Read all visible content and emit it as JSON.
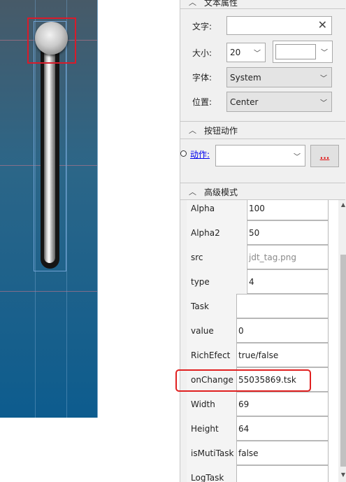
{
  "text_section": {
    "header": "文本属性",
    "text_label": "文字:",
    "text_value": "",
    "size_label": "大小:",
    "size_value": "20",
    "size_color_value": "",
    "font_label": "字体:",
    "font_value": "System",
    "position_label": "位置:",
    "position_value": "Center"
  },
  "button_action_section": {
    "header": "按钮动作",
    "action_link": "动作:",
    "action_value": "",
    "browse_label": "..."
  },
  "advanced_section": {
    "header": "高级模式",
    "properties": [
      {
        "key": "Alpha",
        "value": "100"
      },
      {
        "key": "Alpha2",
        "value": "50"
      },
      {
        "key": "src",
        "value": "jdt_tag.png"
      },
      {
        "key": "type",
        "value": "4"
      },
      {
        "key": "Task",
        "value": ""
      },
      {
        "key": "value",
        "value": "0"
      },
      {
        "key": "RichEfect",
        "value": "true/false"
      },
      {
        "key": "onChange",
        "value": "55035869.tsk"
      },
      {
        "key": "Width",
        "value": "69"
      },
      {
        "key": "Height",
        "value": "64"
      },
      {
        "key": "isMutiTask",
        "value": "false"
      },
      {
        "key": "LogTask",
        "value": ""
      }
    ]
  },
  "colors": {
    "highlight": "#e02020",
    "link": "#0000ee",
    "canvas_top": "#475a68",
    "canvas_bottom": "#0d5c8e"
  }
}
